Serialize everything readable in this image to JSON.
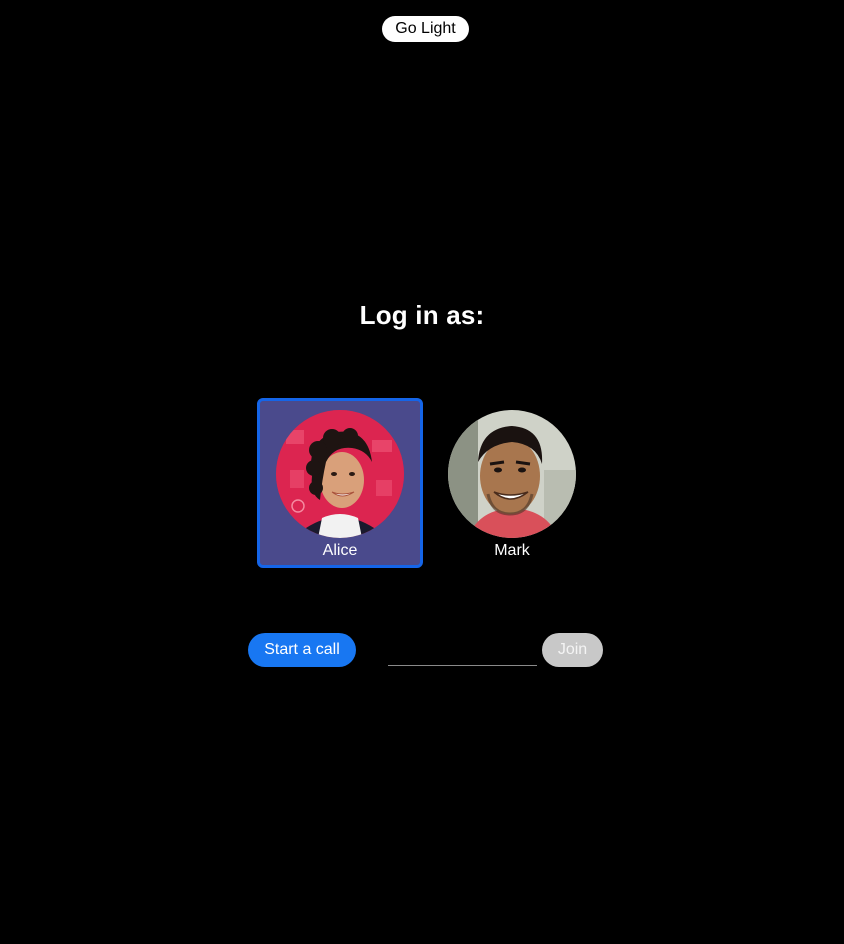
{
  "header": {
    "theme_toggle_label": "Go Light"
  },
  "login": {
    "title": "Log in as:",
    "users": [
      {
        "name": "Alice",
        "selected": true
      },
      {
        "name": "Mark",
        "selected": false
      }
    ]
  },
  "call": {
    "start_label": "Start a call",
    "call_id_placeholder": "",
    "call_id_value": "",
    "join_label": "Join"
  },
  "colors": {
    "background": "#000000",
    "selected_card_bg": "#4a4a8c",
    "selected_card_border": "#1565e8",
    "primary_button": "#1877f2",
    "disabled_button": "#c8c8c8"
  }
}
